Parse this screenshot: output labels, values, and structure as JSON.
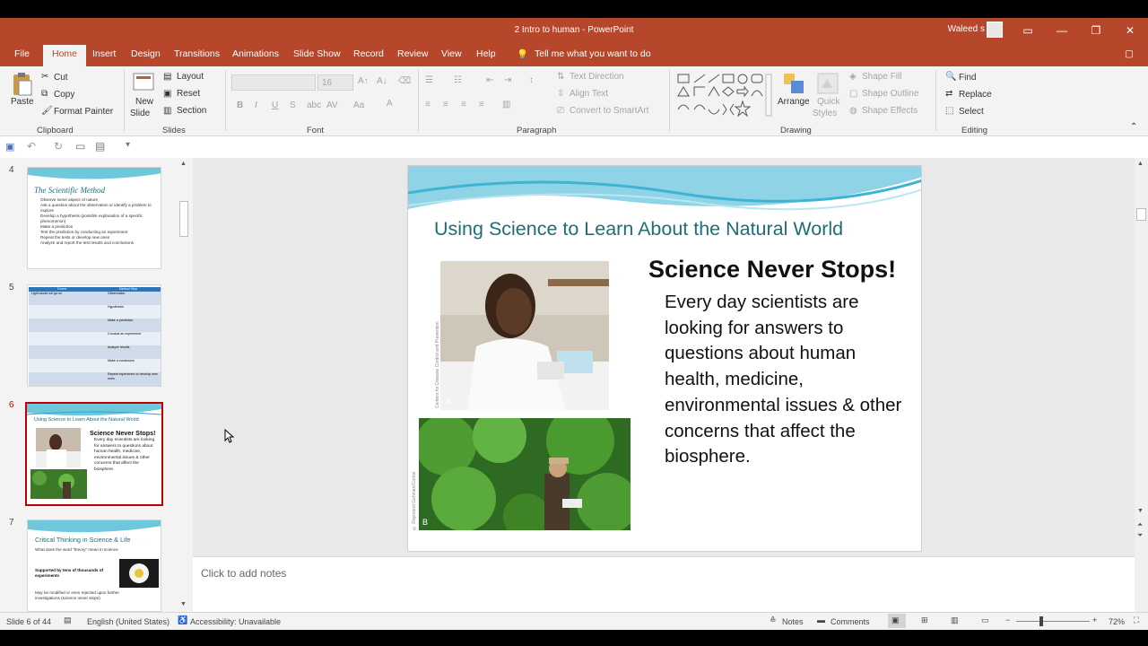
{
  "window": {
    "title": "2 Intro to human  -  PowerPoint",
    "user": "Waleed s"
  },
  "menu": {
    "tabs": [
      "File",
      "Home",
      "Insert",
      "Design",
      "Transitions",
      "Animations",
      "Slide Show",
      "Record",
      "Review",
      "View",
      "Help"
    ],
    "tell_me": "Tell me what you want to do"
  },
  "ribbon": {
    "clipboard": {
      "paste": "Paste",
      "cut": "Cut",
      "copy": "Copy",
      "format_painter": "Format Painter",
      "group": "Clipboard"
    },
    "slides": {
      "new_slide_1": "New",
      "new_slide_2": "Slide",
      "layout": "Layout",
      "reset": "Reset",
      "section": "Section",
      "group": "Slides"
    },
    "font": {
      "size": "16",
      "group": "Font"
    },
    "paragraph": {
      "text_direction": "Text Direction",
      "align_text": "Align Text",
      "convert": "Convert to SmartArt",
      "group": "Paragraph"
    },
    "drawing": {
      "arrange": "Arrange",
      "quick_styles_1": "Quick",
      "quick_styles_2": "Styles",
      "shape_fill": "Shape Fill",
      "shape_outline": "Shape Outline",
      "shape_effects": "Shape Effects",
      "group": "Drawing"
    },
    "editing": {
      "find": "Find",
      "replace": "Replace",
      "select": "Select",
      "group": "Editing"
    }
  },
  "thumbnails": [
    {
      "num": "4",
      "title": "The Scientific Method",
      "bullets": [
        "Observe some aspect of nature",
        "Ask a question about the observation or identify a problem to explore",
        "Develop a hypothesis (possible explanation of a specific phenomenon)",
        "Make a prediction",
        "Test the prediction by conducting an experiment",
        "Repeat the tests or develop new ones",
        "Analyze and report the test results and conclusions"
      ]
    },
    {
      "num": "5",
      "col1": "Event",
      "col2": "Method Step",
      "rows": [
        [
          "Light would not go on",
          "Observation"
        ],
        [
          "",
          "Hypothesis"
        ],
        [
          "",
          "Make a prediction"
        ],
        [
          "",
          "Conduct an experiment"
        ],
        [
          "",
          "Analyze results"
        ],
        [
          "",
          "Make a conclusion"
        ],
        [
          "",
          "Repeat experiment or develop new ones"
        ]
      ]
    },
    {
      "num": "6",
      "title": "Using Science to Learn About the Natural World",
      "heading": "Science Never Stops!",
      "body": "Every day scientists are looking for answers to questions about human health, medicine, environmental issues & other concerns that affect the biosphere."
    },
    {
      "num": "7",
      "title": "Critical Thinking in Science & Life",
      "line1": "What does the word \"theory\" mean in science",
      "line2": "Supported by tens of thousands of experiments",
      "line3": "May be modified or even rejected upon further investigations (science never stops)"
    }
  ],
  "slide": {
    "title": "Using Science to Learn About the Natural World",
    "heading": "Science Never Stops!",
    "body": "Every day scientists are looking for answers to questions about human health, medicine, environmental issues & other concerns that affect the biosphere.",
    "photo_a_label": "A",
    "photo_b_label": "B",
    "photo_a_credit": "Centers for Disease Control and Prevention",
    "photo_b_credit": "© Raymond Gehman/Corbis"
  },
  "notes": {
    "placeholder": "Click to add notes"
  },
  "status": {
    "slide": "Slide 6 of 44",
    "language": "English (United States)",
    "accessibility": "Accessibility: Unavailable",
    "notes": "Notes",
    "comments": "Comments",
    "zoom": "72%"
  },
  "colors": {
    "accent": "#b7472a",
    "slide_title": "#1f6d7a",
    "selected_border": "#c00000"
  }
}
